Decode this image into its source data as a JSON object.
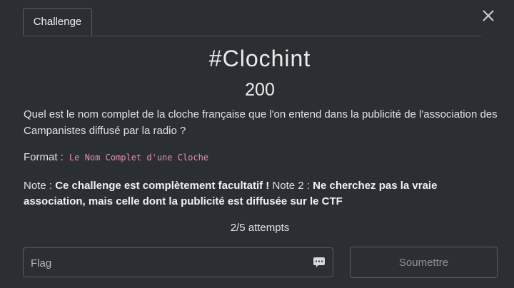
{
  "tabs": [
    {
      "label": "Challenge"
    }
  ],
  "challenge": {
    "name": "#Clochint",
    "value": "200",
    "description": "Quel est le nom complet de la cloche française que l'on entend dans la publicité de l'association des Campanistes diffusé par la radio ?",
    "format_label": "Format :",
    "format_code": "Le Nom Complet d'une Cloche",
    "note1_label": "Note :",
    "note1_text": "Ce challenge est complètement facultatif !",
    "note2_label": "Note 2 :",
    "note2_text": "Ne cherchez pas la vraie association, mais celle dont la publicité est diffusée sur le CTF"
  },
  "attempts": "2/5 attempts",
  "flag_input": {
    "placeholder": "Flag",
    "value": ""
  },
  "submit_label": "Soumettre",
  "icons": {
    "close": "close-icon",
    "keyboard": "keyboard-icon"
  },
  "colors": {
    "background": "#2b2e33",
    "code": "#e78fb1",
    "border": "#575b61"
  }
}
